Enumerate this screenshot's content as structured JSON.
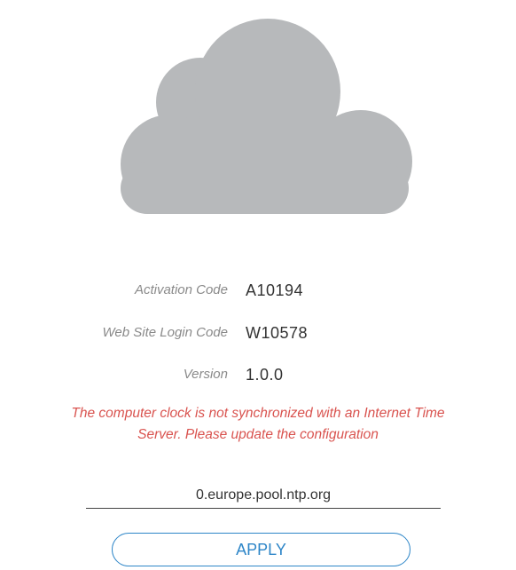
{
  "icon": "cloud-icon",
  "colors": {
    "cloud": "#b7b9bb",
    "label": "#8a8a8a",
    "value": "#333333",
    "warning": "#d9534f",
    "accent": "#2e86c8"
  },
  "info": {
    "activation": {
      "label": "Activation Code",
      "value": "A10194"
    },
    "login": {
      "label": "Web Site Login Code",
      "value": "W10578"
    },
    "version": {
      "label": "Version",
      "value": "1.0.0"
    }
  },
  "warning": {
    "line1": "The computer clock is not synchronized with an Internet Time",
    "line2": "Server. Please update the configuration"
  },
  "time_server": {
    "value": "0.europe.pool.ntp.org"
  },
  "apply_label": "APPLY"
}
